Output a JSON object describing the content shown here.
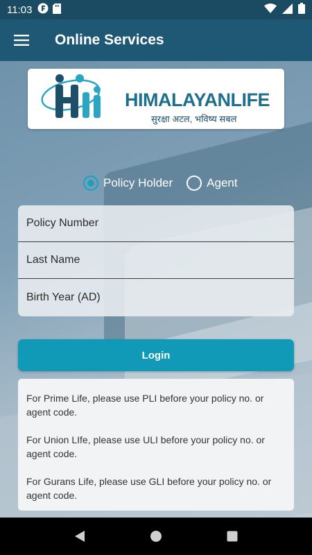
{
  "status_bar": {
    "time": "11:03",
    "icons": [
      "app-f-icon",
      "sd-card-icon",
      "wifi-icon",
      "signal-icon",
      "battery-icon"
    ]
  },
  "app_bar": {
    "title": "Online Services",
    "menu_icon": "hamburger-menu-icon"
  },
  "logo": {
    "brand": "HIMALAYANLIFE",
    "tagline": "सुरक्षा अटल, भविष्य सबल",
    "colors": {
      "primary": "#1d6f8b",
      "accent": "#2aa6c4"
    }
  },
  "login_type": {
    "options": [
      "Policy Holder",
      "Agent"
    ],
    "selected": "Policy Holder"
  },
  "form": {
    "policy_number_placeholder": "Policy Number",
    "last_name_placeholder": "Last Name",
    "birth_year_placeholder": "Birth Year (AD)"
  },
  "login_button": "Login",
  "info": [
    "For Prime Life, please use PLI before your policy no. or agent code.",
    " For Union LIfe, please use ULI before your policy no. or agent code.",
    " For Gurans Life, please use GLI before your policy no. or agent code."
  ],
  "nav_bar": {
    "icons": [
      "back-icon",
      "home-icon",
      "recents-icon"
    ]
  },
  "colors": {
    "app_bar": "#1f5874",
    "status_bar": "#1b4a63",
    "button": "#109ab7",
    "radio_selected": "#17a2c4"
  }
}
